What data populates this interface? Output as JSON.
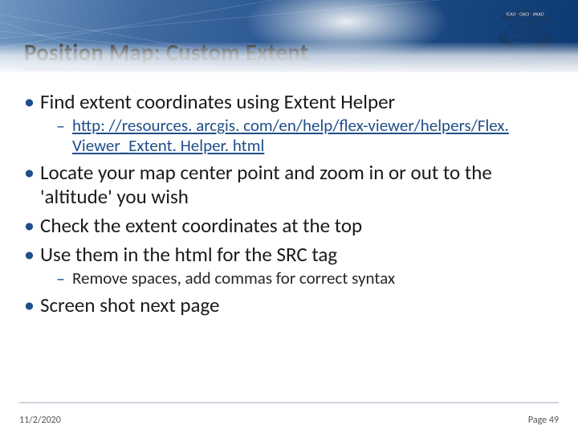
{
  "header": {
    "title": "Position Map: Custom Extent",
    "logo_name": "icao-logo"
  },
  "bullets": [
    {
      "text": "Find extent coordinates using Extent Helper",
      "sub": [
        {
          "type": "link",
          "text": "http: //resources. arcgis. com/en/help/flex-viewer/helpers/Flex. Viewer_Extent. Helper. html"
        }
      ]
    },
    {
      "text": "Locate your map center point and zoom in or out to the 'altitude' you wish"
    },
    {
      "text": "Check the extent coordinates at the top"
    },
    {
      "text": "Use them in the html for the SRC tag",
      "sub": [
        {
          "type": "text",
          "text": "Remove spaces, add commas for correct syntax"
        }
      ]
    },
    {
      "text": "Screen shot next page"
    }
  ],
  "footer": {
    "date": "11/2/2020",
    "page_label": "Page 49"
  }
}
